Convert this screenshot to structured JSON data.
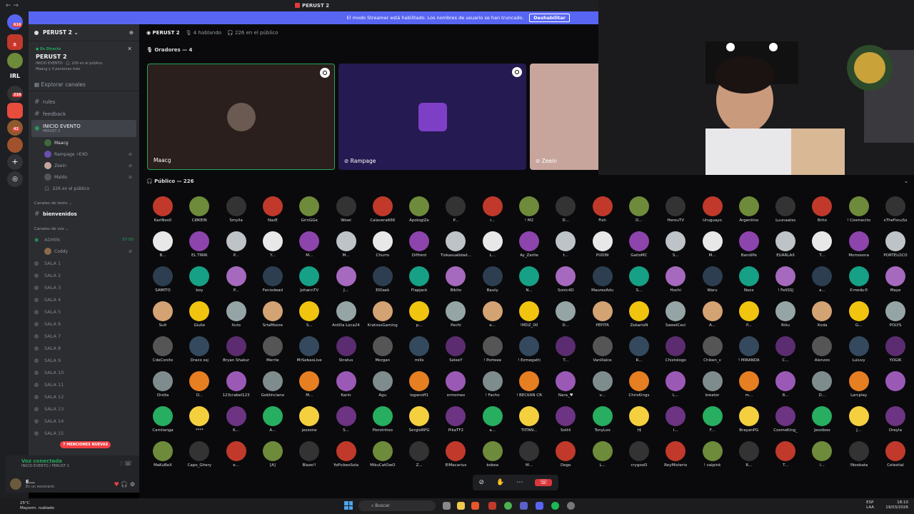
{
  "titlebar": {
    "title": "PERUST 2"
  },
  "banner": {
    "text": "El modo Streamer está habilitado. Los nombres de usuario se han truncado.",
    "button": "Deshabilitar"
  },
  "rail": {
    "badges": [
      "616",
      "5",
      "210",
      "42"
    ],
    "labels": [
      "IRL"
    ]
  },
  "server": {
    "name": "PERUST 2 ⌄",
    "live_label": "● En Directo",
    "live_name": "PERUST 2",
    "live_sub1": "INICIO EVENTO · 🎧 226 en el público",
    "live_sub2": "Maacg y 3 personas más",
    "explore": "Explorar canales"
  },
  "channels": [
    {
      "name": "rules"
    },
    {
      "name": "feedback"
    }
  ],
  "active_stage": {
    "name": "INICIO EVENTO",
    "sub": "PERUST 2",
    "users": [
      "Maacg",
      "Rampage ⚡EXO",
      "Zeein",
      "Maldo"
    ],
    "audience": "226 en el público"
  },
  "text_category": "Canales de texto ⌄",
  "text_channels": [
    "bienvenidos"
  ],
  "voice_category": "Canales de voz ⌄",
  "voice_admin": {
    "name": "ADMIN",
    "time": "37:50",
    "user": "Coddy"
  },
  "salas": [
    "SALA 1",
    "SALA 2",
    "SALA 3",
    "SALA 4",
    "SALA 5",
    "SALA 6",
    "SALA 7",
    "SALA 8",
    "SALA 9",
    "SALA 10",
    "SALA 11",
    "SALA 12",
    "SALA 13",
    "SALA 14",
    "SALA 15"
  ],
  "mentions": "7 MENCIONES NUEVAS",
  "voicepanel": {
    "status": "Voz conectada",
    "sub": "INICIO EVENTO / PERUST 2"
  },
  "userbar": {
    "name": "E...",
    "status": "En un escenario"
  },
  "stage": {
    "name": "PERUST 2",
    "speaking": "4 hablando",
    "public": "226 en el público",
    "speakers_label": "Oradores — 4",
    "tiles": [
      "Maacg",
      "Rampage",
      "Zeein"
    ]
  },
  "public_label": "Público — 226",
  "audience": [
    "KariÑos0",
    "CØKEIN",
    "Smylla",
    "NazE",
    "GrinGGe",
    "Wowi",
    "Calavera666",
    "ApologiZe",
    "P...",
    "r...",
    "! M2",
    "D...",
    "Fish",
    "D...",
    "HerouTV",
    "Uruguayo",
    "Argentino",
    "Luunaatss",
    "Brito",
    "! Cosmecito",
    "xTheFocuSx",
    "B...",
    "EL TIRRI",
    "P...",
    "Y...",
    "M...",
    "M...",
    "Churro",
    "Diffrent",
    "Tiokasualidad...",
    "L...",
    "Ay_Zarite",
    "t...",
    "PUDÍN",
    "GaitoMC",
    "S...",
    "M...",
    "BandiPe",
    "EUARLAX",
    "T...",
    "Momosora",
    "PORTELOCO",
    "SAMITO",
    "boy",
    "P...",
    "Fenixdead",
    "JohannTV",
    "J...",
    "ElDaek",
    "Flapjack",
    "Bikito",
    "Bauty",
    "N...",
    "Sonic4D",
    "MaurexAdu",
    "S...",
    "Hochi",
    "Waru",
    "Noxx",
    "! FeliSSJ",
    "a...",
    "©medu©",
    "Maye",
    "Suit",
    "Giulio",
    "Xuto",
    "SrtaMoore",
    "S...",
    "Ardilla Loca24",
    "KratossGaming",
    "p...",
    "Pechi",
    "e...",
    "!MDZ_00",
    "D...",
    "PEPITA",
    "ZekarioN",
    "SweetCeci",
    "A...",
    "P...",
    "Riku",
    "Xoda",
    "G...",
    "POLYS",
    "CdeConito",
    "Draco ssj",
    "Bryan Shakur",
    "Merrie",
    "MrSebasLive",
    "Stratus",
    "Morgan",
    "mills",
    "SeleeY",
    "! Porteee",
    "! Ezmegatti",
    "T...",
    "Vanillalce",
    "R...",
    "Chistologo",
    "Chiken_v",
    "! MIRANDA",
    "C...",
    "Alonzzo",
    "Luluvy",
    "YOGIK",
    "Orsita",
    "O...",
    "123crabel123",
    "Goblinciano",
    "M...",
    "Karin",
    "Agu",
    "loganoff1",
    "srmomex",
    "! Facho",
    "! BECKAN CR",
    "Nara_♥",
    "v...",
    "ChrisKings",
    "L...",
    "kreator",
    "m...",
    "R...",
    "D...",
    "Larcplay",
    "",
    "Camilanga",
    "****",
    "K...",
    "A...",
    "jezzone",
    "S...",
    "Pierzinhoo",
    "SergioRPG",
    "PikaTF2",
    "a...",
    "TIITAN...",
    "Soliiii",
    "TonyLoo",
    "†ǂ",
    "I...",
    "F...",
    "BrayanPG",
    "CosmoKing_",
    "Jessiboo",
    "J...",
    "Dreyla",
    "MaKuBeX",
    "Capo_Ghery",
    "e...",
    "[A]",
    "Blaze!!",
    "YoPickeoSola",
    "MikuCatOwO",
    "Z...",
    "ElMacarius",
    "kobea",
    "M...",
    "Dego",
    "L...",
    "crygooD",
    "ReyMisterio",
    "! valpink",
    "R...",
    "T...",
    "I...",
    "!Noobata",
    "Celestial"
  ],
  "controls": [
    "mute-icon",
    "hand-icon",
    "more-icon",
    "leave-icon"
  ],
  "taskbar": {
    "temp": "25°C",
    "weather": "Mayorm. nublado",
    "search": "Buscar",
    "lang1": "ESP",
    "lang2": "LAA",
    "time": "18:10",
    "date": "19/03/2026"
  }
}
